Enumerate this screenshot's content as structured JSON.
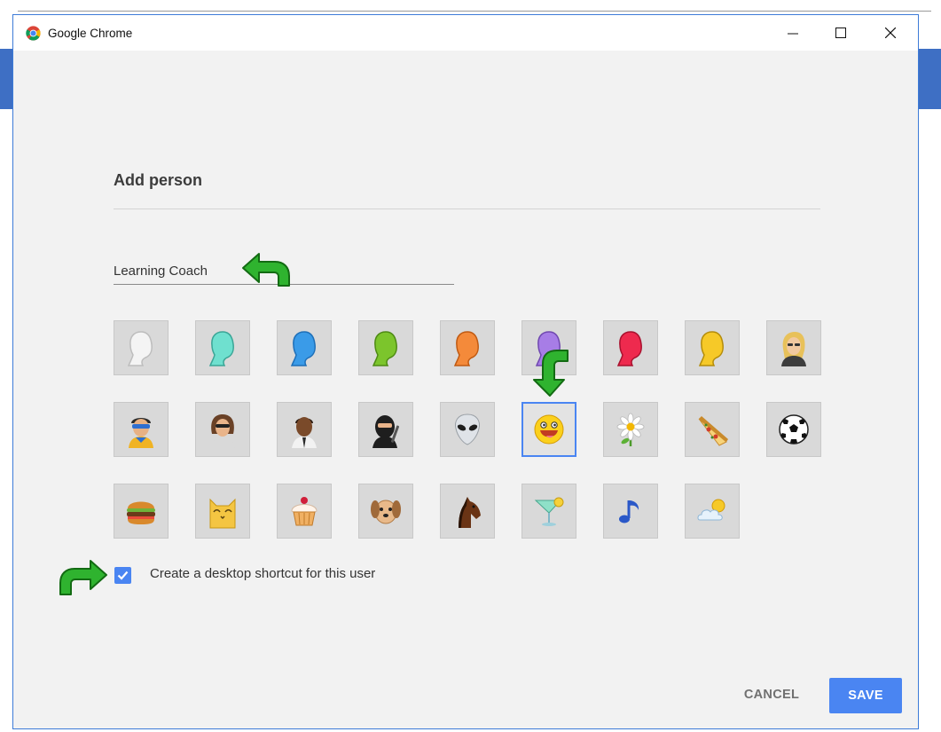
{
  "window": {
    "title": "Google Chrome"
  },
  "dialog": {
    "heading": "Add person",
    "name_value": "Learning Coach",
    "shortcut_label": "Create a desktop shortcut for this user",
    "shortcut_checked": true,
    "cancel_label": "CANCEL",
    "save_label": "SAVE",
    "selected_avatar": "avatar-smiley",
    "accent_color": "#4a85f2"
  },
  "avatars": [
    "generic-white",
    "generic-teal",
    "generic-blue",
    "generic-green",
    "generic-orange",
    "generic-purple",
    "generic-red",
    "generic-yellow",
    "businesswoman",
    "superhero",
    "diva",
    "businessman",
    "ninja",
    "alien",
    "smiley",
    "flower",
    "pizza",
    "soccer-ball",
    "burger",
    "cat",
    "cupcake",
    "dog",
    "horse",
    "margarita",
    "music-note",
    "sun-and-cloud"
  ],
  "annotations": [
    "green-arrow-name",
    "green-arrow-smiley",
    "green-arrow-checkbox"
  ]
}
